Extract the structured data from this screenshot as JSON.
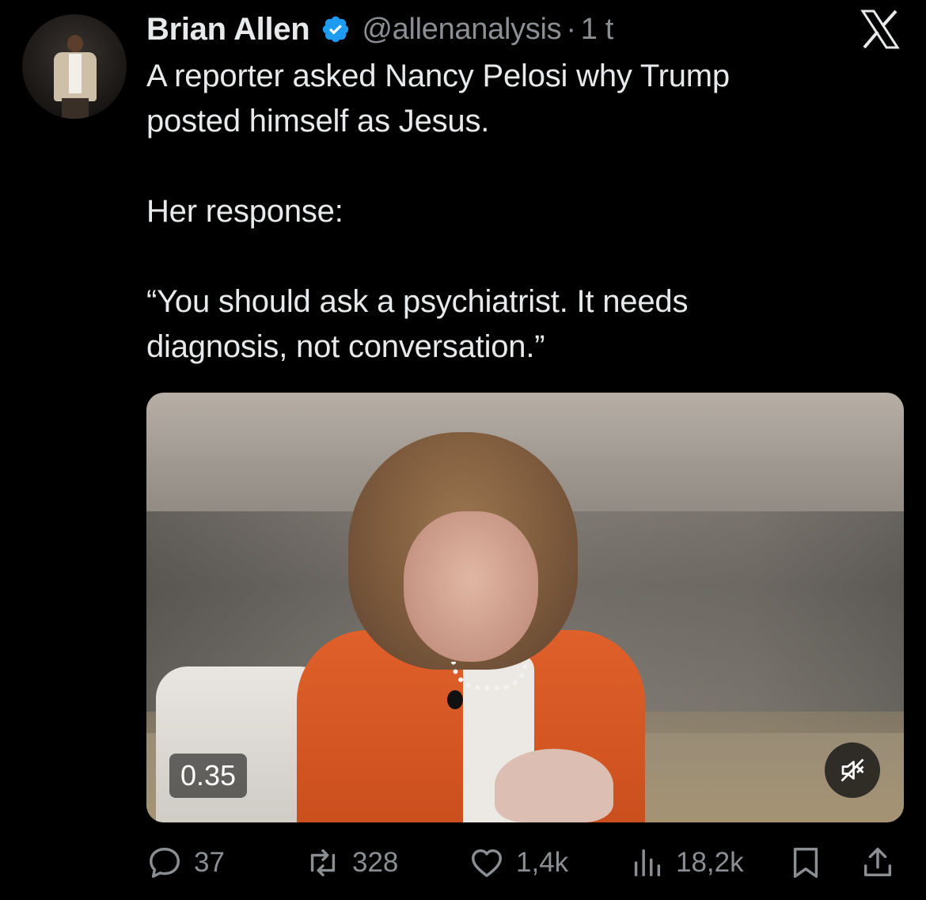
{
  "tweet": {
    "author_name": "Brian Allen",
    "author_handle": "@allenanalysis",
    "separator": "·",
    "time": "1 t",
    "text": "A reporter asked Nancy Pelosi why Trump\nposted himself as Jesus.\n\nHer response:\n\n“You should ask a psychiatrist. It needs\ndiagnosis, not conversation.”"
  },
  "media": {
    "timestamp": "0.35",
    "muted": true
  },
  "actions": {
    "replies": "37",
    "reposts": "328",
    "likes": "1,4k",
    "views": "18,2k"
  },
  "colors": {
    "background": "#000000",
    "text": "#e7e9ea",
    "muted": "#8b8f94",
    "verified": "#1d9bf0"
  },
  "icons": {
    "verified": "verified-badge-icon",
    "logo": "x-logo-icon",
    "mute": "muted-speaker-icon",
    "reply": "reply-icon",
    "repost": "repost-icon",
    "like": "heart-icon",
    "views": "views-icon",
    "bookmark": "bookmark-icon",
    "share": "share-icon"
  }
}
